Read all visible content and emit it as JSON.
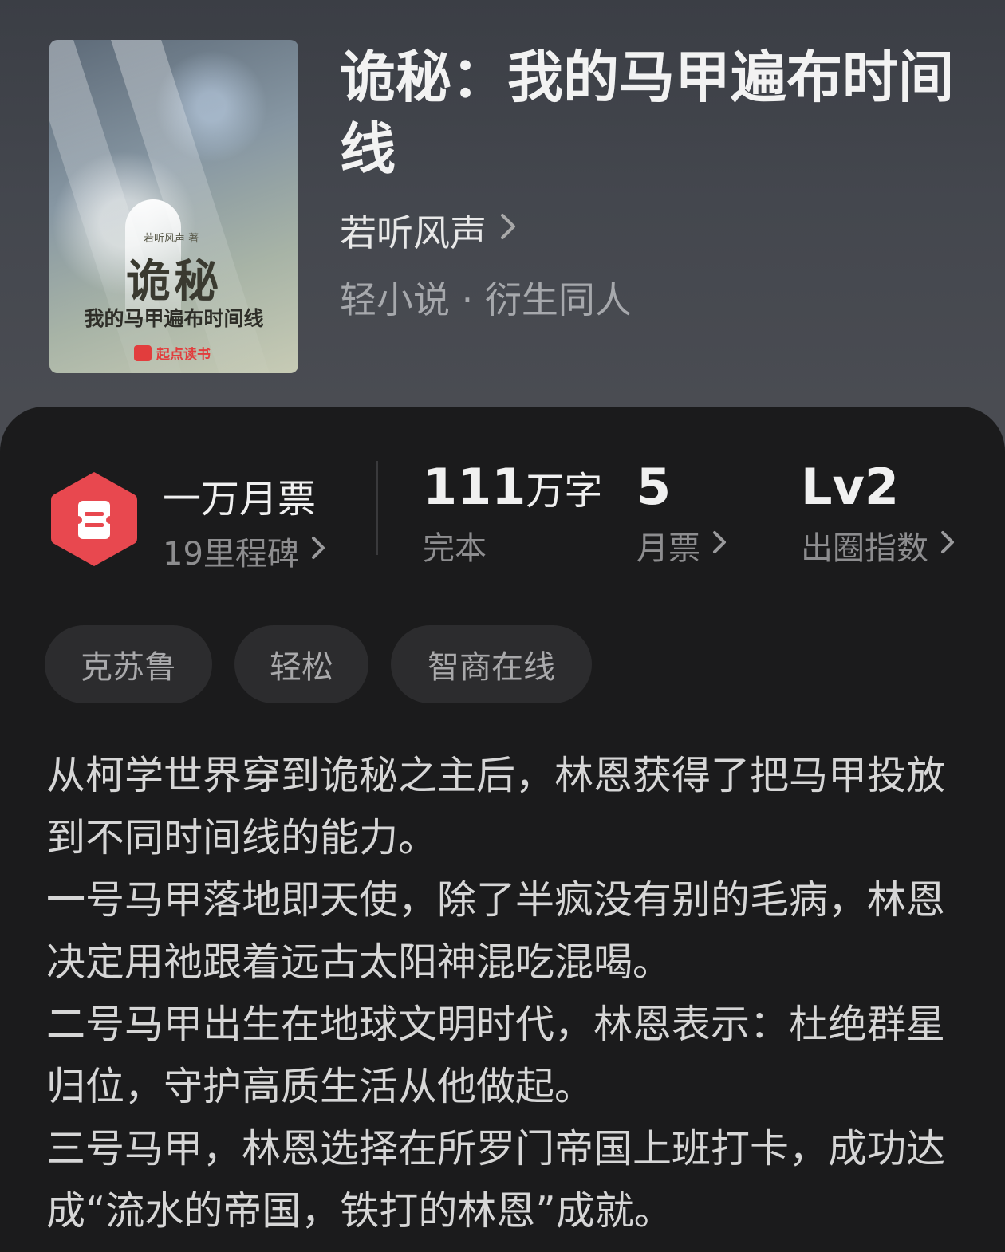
{
  "book": {
    "title": "诡秘：我的马甲遍布时间线",
    "author": "若听风声",
    "genre": "轻小说 · 衍生同人",
    "cover": {
      "author_text": "若听风声  著",
      "title_big": "诡秘",
      "title_small": "我的马甲遍布时间线",
      "brand": "起点读书"
    }
  },
  "stats": {
    "badge": {
      "title": "一万月票",
      "subtitle": "19里程碑"
    },
    "word_count": {
      "number": "111",
      "unit": "万字",
      "label": "完本"
    },
    "monthly_ticket": {
      "value": "5",
      "label": "月票"
    },
    "popularity": {
      "value": "Lv2",
      "label": "出圈指数"
    }
  },
  "tags": [
    "克苏鲁",
    "轻松",
    "智商在线"
  ],
  "description": [
    "从柯学世界穿到诡秘之主后，林恩获得了把马甲投放到不同时间线的能力。",
    "一号马甲落地即天使，除了半疯没有别的毛病，林恩决定用祂跟着远古太阳神混吃混喝。",
    "二号马甲出生在地球文明时代，林恩表示：杜绝群星归位，守护高质生活从他做起。",
    "三号马甲，林恩选择在所罗门帝国上班打卡，成功达成“流水的帝国，铁打的林恩”成就。"
  ],
  "colors": {
    "panel_bg": "#1b1b1c",
    "badge_red": "#e8484f",
    "tag_bg": "#2c2c2e"
  }
}
